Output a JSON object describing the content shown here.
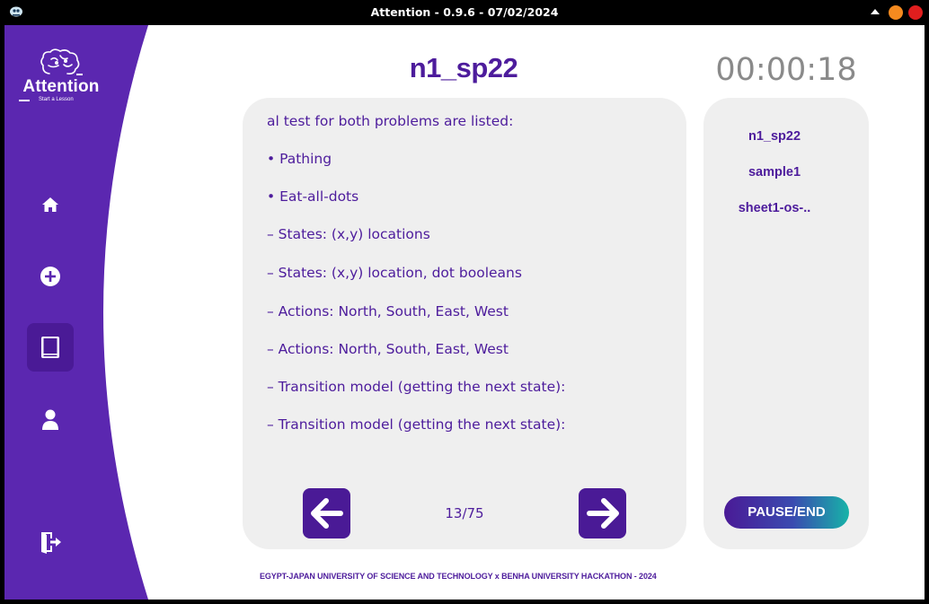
{
  "window": {
    "title": "Attention - 0.9.6 - 07/02/2024"
  },
  "logo": {
    "name": "Attention",
    "tagline": "Start a Lesson"
  },
  "sidebar": {
    "items": [
      {
        "icon": "home-icon"
      },
      {
        "icon": "add-icon"
      },
      {
        "icon": "book-icon",
        "active": true
      },
      {
        "icon": "user-icon"
      },
      {
        "icon": "logout-icon"
      }
    ]
  },
  "lesson": {
    "title": "n1_sp22",
    "timer": "00:00:18"
  },
  "content": {
    "lines": [
      "al test for both problems are listed:",
      "• Pathing",
      "• Eat-all-dots",
      "– States: (x,y) locations",
      "– States: (x,y) location, dot booleans",
      "– Actions: North, South, East, West",
      "– Actions: North, South, East, West",
      "– Transition model (getting the next state):",
      "– Transition model (getting the next state):"
    ],
    "page_counter": "13/75"
  },
  "files": {
    "items": [
      "n1_sp22",
      "sample1",
      "sheet1-os-.."
    ],
    "pause_label": "PAUSE/END"
  },
  "footer": {
    "text": "EGYPT-JAPAN UNIVERSITY OF SCIENCE AND TECHNOLOGY x BENHA UNIVERSITY HACKATHON - 2024"
  },
  "colors": {
    "primary": "#5b27b0",
    "primary_dark": "#4a1a96",
    "card": "#efefef",
    "timer": "#8a8a8a"
  }
}
